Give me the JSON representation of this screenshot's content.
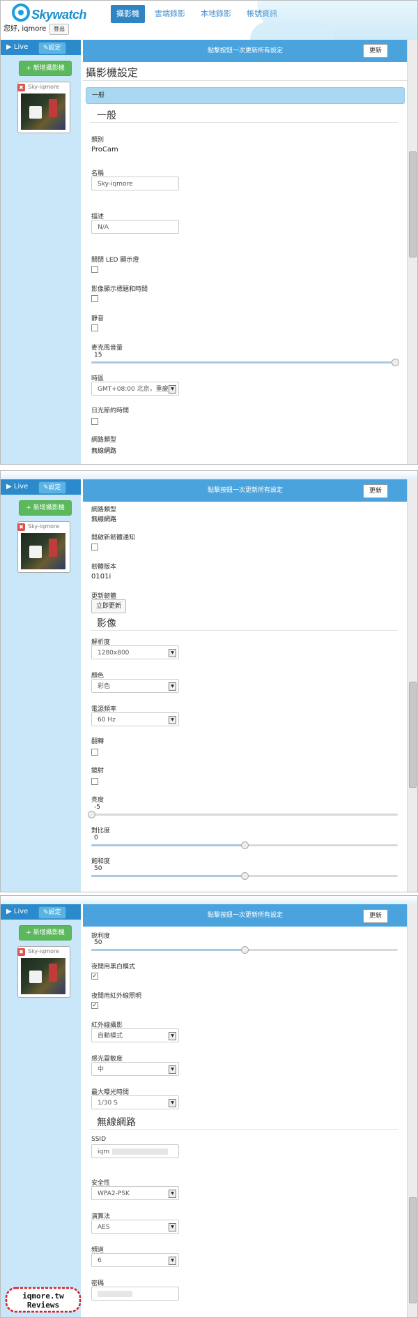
{
  "app": {
    "logo_text": "Skywatch",
    "greeting": "您好, iqmore",
    "logout": "登出",
    "tabs": [
      "攝影機",
      "雲端錄影",
      "本地錄影",
      "帳號資訊"
    ]
  },
  "sidebar": {
    "live": "Live",
    "settings": "設定",
    "add_camera": "新增攝影機",
    "camera_name": "Sky-iqmore"
  },
  "header": {
    "notice": "點擊按鈕一次更新所有設定",
    "update": "更新",
    "page_title": "攝影機設定",
    "tab_general": "一般"
  },
  "general": {
    "heading": "一般",
    "category_label": "類別",
    "category": "ProCam",
    "name_label": "名稱",
    "name": "Sky-iqmore",
    "desc_label": "描述",
    "desc_placeholder": "N/A",
    "led_label": "關閉 LED 顯示燈",
    "overlay_label": "影像顯示標題和時間",
    "mute_label": "靜音",
    "mic_label": "麥克風音量",
    "mic": "15",
    "tz_label": "時區",
    "tz": "GMT+08:00 北京，重慶",
    "dst_label": "日光節約時間",
    "net_label": "網路類型",
    "net": "無線網路",
    "fwnotify_label": "開啟新韌體通知",
    "fwver_label": "韌體版本",
    "fwver": "0101i",
    "fwupdate_label": "更新韌體",
    "fwupdate_btn": "立即更新"
  },
  "video": {
    "heading": "影像",
    "res_label": "解析度",
    "res": "1280x800",
    "color_label": "顏色",
    "color": "彩色",
    "freq_label": "電源頻率",
    "freq": "60 Hz",
    "flip_label": "翻轉",
    "mirror_label": "鏡射",
    "bright_label": "亮度",
    "bright": "-5",
    "contrast_label": "對比度",
    "contrast": "0",
    "sat_label": "飽和度",
    "sat": "50",
    "sharp_label": "銳利度",
    "sharp": "50",
    "nightbw_label": "夜間用黑白模式",
    "nightir_label": "夜間用紅外線照明",
    "ir_label": "紅外線攝影",
    "ir": "自動模式",
    "sens_label": "感光靈敏度",
    "sens": "中",
    "exp_label": "最大曝光時間",
    "exp": "1/30 S"
  },
  "wifi": {
    "heading": "無線網路",
    "ssid_label": "SSID",
    "ssid": "iqm",
    "sec_label": "安全性",
    "sec": "WPA2-PSK",
    "alg_label": "演算法",
    "alg": "AES",
    "ch_label": "頻道",
    "ch": "6",
    "pwd_label": "密碼"
  },
  "badge": {
    "line1": "iqmore.tw",
    "line2": "Reviews"
  },
  "colors": {
    "accent": "#2a8acb",
    "notice": "#4aa3dd",
    "sidebar": "#c9e7f8",
    "add": "#5cb85c"
  },
  "sliders": {
    "mic": 0.99,
    "bright": 0.0,
    "contrast": 0.5,
    "sat": 0.5,
    "sharp": 0.5
  }
}
